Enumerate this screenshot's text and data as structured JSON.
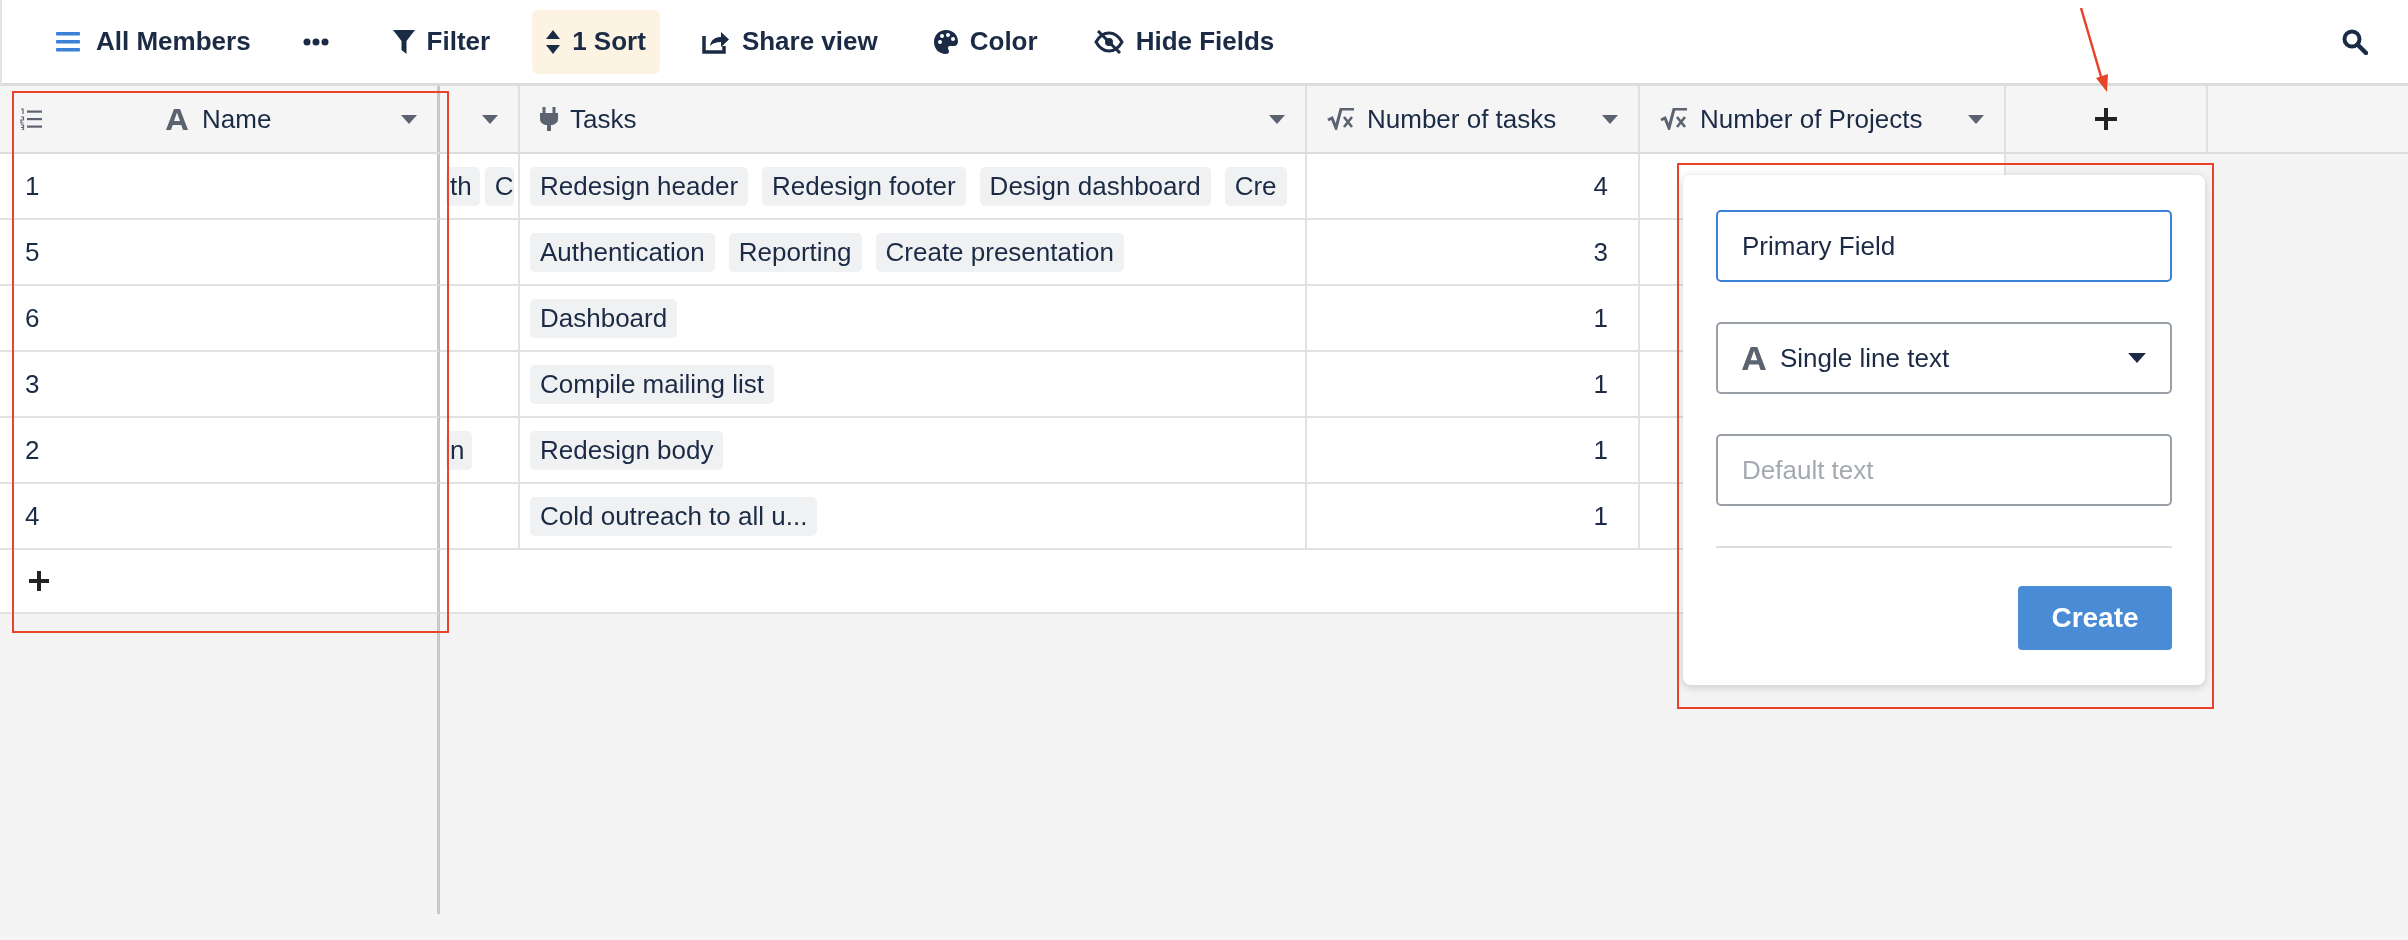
{
  "toolbar": {
    "view": {
      "label": "All Members"
    },
    "actions": [
      {
        "kind": "filter",
        "label": "Filter",
        "active": false
      },
      {
        "kind": "sort",
        "label": "1 Sort",
        "active": true
      },
      {
        "kind": "share",
        "label": "Share view",
        "active": false
      },
      {
        "kind": "color",
        "label": "Color",
        "active": false
      },
      {
        "kind": "hide",
        "label": "Hide Fields",
        "active": false
      }
    ]
  },
  "table": {
    "columns": [
      {
        "kind": "primary",
        "label": "Name"
      },
      {
        "kind": "partial"
      },
      {
        "kind": "link",
        "label": "Tasks"
      },
      {
        "kind": "formula",
        "label": "Number of tasks"
      },
      {
        "kind": "formula",
        "label": "Number of Projects"
      },
      {
        "kind": "add"
      }
    ],
    "rows": [
      {
        "name": "1",
        "column_2": [
          "th",
          "C"
        ],
        "tasks": [
          "Redesign header",
          "Redesign footer",
          "Design dashboard",
          "Cre"
        ],
        "number_of_tasks": "4"
      },
      {
        "name": "5",
        "column_2": [],
        "tasks": [
          "Authentication",
          "Reporting",
          "Create presentation"
        ],
        "number_of_tasks": "3"
      },
      {
        "name": "6",
        "column_2": [],
        "tasks": [
          "Dashboard"
        ],
        "number_of_tasks": "1"
      },
      {
        "name": "3",
        "column_2": [],
        "tasks": [
          "Compile mailing list"
        ],
        "number_of_tasks": "1"
      },
      {
        "name": "2",
        "column_2": [
          "n"
        ],
        "tasks": [
          "Redesign body"
        ],
        "number_of_tasks": "1"
      },
      {
        "name": "4",
        "column_2": [],
        "tasks": [
          "Cold outreach to all u..."
        ],
        "number_of_tasks": "1"
      }
    ]
  },
  "field_popup": {
    "name_value": "Primary Field",
    "type": {
      "label": "Single line text"
    },
    "default_placeholder": "Default text",
    "create": "Create"
  }
}
